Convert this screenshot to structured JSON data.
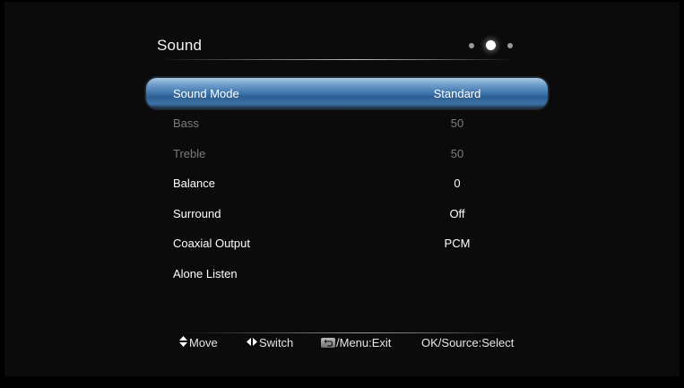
{
  "header": {
    "title": "Sound",
    "page_indicator": {
      "count": 3,
      "active": 2
    }
  },
  "menu": {
    "items": [
      {
        "label": "Sound Mode",
        "value": "Standard",
        "state": "selected"
      },
      {
        "label": "Bass",
        "value": "50",
        "state": "disabled"
      },
      {
        "label": "Treble",
        "value": "50",
        "state": "disabled"
      },
      {
        "label": "Balance",
        "value": "0",
        "state": "normal"
      },
      {
        "label": "Surround",
        "value": "Off",
        "state": "normal"
      },
      {
        "label": "Coaxial Output",
        "value": "PCM",
        "state": "normal"
      },
      {
        "label": "Alone Listen",
        "value": "",
        "state": "normal"
      }
    ]
  },
  "footer": {
    "move": "Move",
    "move_icon": "up-down-arrows-icon",
    "switch": "Switch",
    "switch_icon": "left-right-arrows-icon",
    "exit": "/Menu:Exit",
    "exit_icon": "back-icon",
    "select": "OK/Source:Select"
  },
  "colors": {
    "background": "#000000",
    "highlight": "#3f76ac",
    "text": "#ffffff",
    "disabled_text": "#7c7c7c"
  }
}
